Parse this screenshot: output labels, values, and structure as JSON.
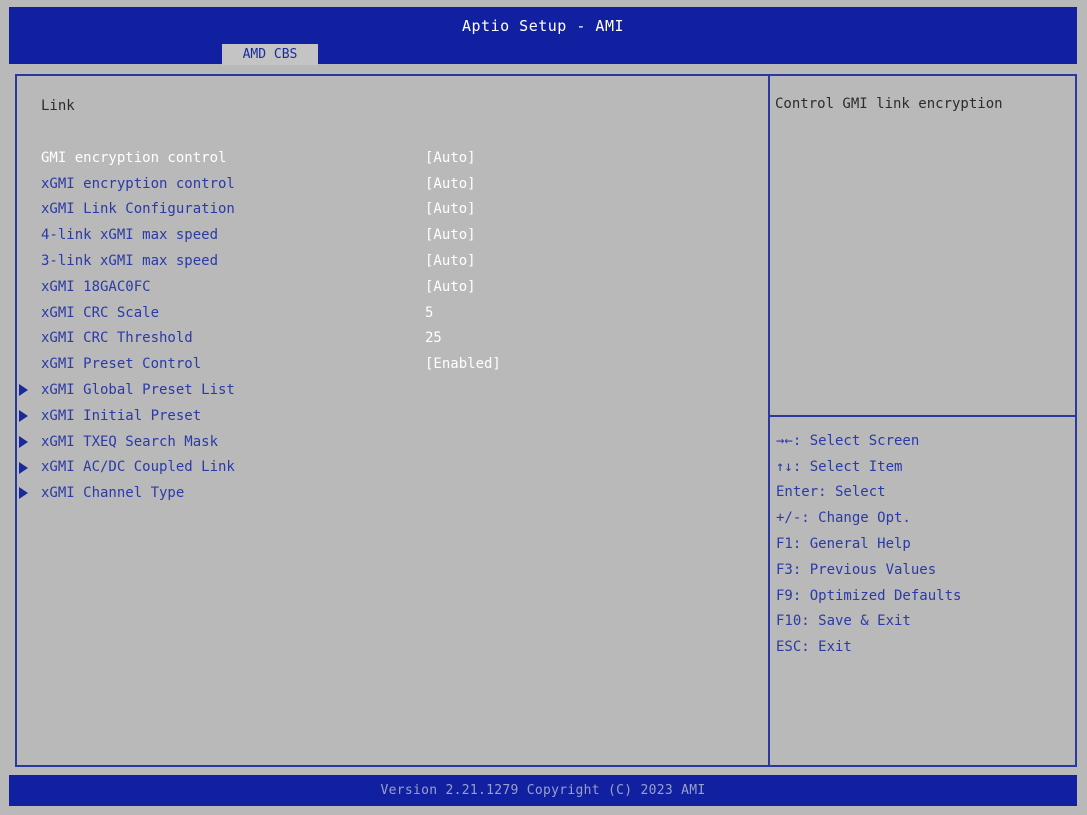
{
  "header": {
    "title": "Aptio Setup - AMI",
    "tab_label": "AMD CBS"
  },
  "main": {
    "section_title": "Link",
    "rows": [
      {
        "label": "GMI encryption control",
        "value": "[Auto]",
        "submenu": false,
        "selected": true
      },
      {
        "label": "xGMI encryption control",
        "value": "[Auto]",
        "submenu": false
      },
      {
        "label": "xGMI Link Configuration",
        "value": "[Auto]",
        "submenu": false
      },
      {
        "label": "4-link xGMI max speed",
        "value": "[Auto]",
        "submenu": false
      },
      {
        "label": "3-link xGMI max speed",
        "value": "[Auto]",
        "submenu": false
      },
      {
        "label": "xGMI 18GAC0FC",
        "value": "[Auto]",
        "submenu": false
      },
      {
        "label": "xGMI CRC Scale",
        "value": "5",
        "submenu": false
      },
      {
        "label": "xGMI CRC Threshold",
        "value": "25",
        "submenu": false
      },
      {
        "label": "xGMI Preset Control",
        "value": "[Enabled]",
        "submenu": false
      },
      {
        "label": "xGMI Global Preset List",
        "value": "",
        "submenu": true
      },
      {
        "label": "xGMI Initial Preset",
        "value": "",
        "submenu": true
      },
      {
        "label": "xGMI TXEQ Search Mask",
        "value": "",
        "submenu": true
      },
      {
        "label": "xGMI AC/DC Coupled Link",
        "value": "",
        "submenu": true
      },
      {
        "label": "xGMI Channel Type",
        "value": "",
        "submenu": true
      }
    ]
  },
  "side": {
    "help_text": "Control GMI link encryption",
    "keys": [
      "→←: Select Screen",
      "↑↓: Select Item",
      "Enter: Select",
      "+/-: Change Opt.",
      "F1: General Help",
      "F3: Previous Values",
      "F9: Optimized Defaults",
      "F10: Save & Exit",
      "ESC: Exit"
    ]
  },
  "footer": {
    "version": "Version 2.21.1279 Copyright (C) 2023 AMI"
  },
  "colors": {
    "bar_blue": "#1020a0",
    "panel_gray": "#b9b9b9",
    "option_blue": "#2a3aa8",
    "value_white": "#ffffff"
  }
}
